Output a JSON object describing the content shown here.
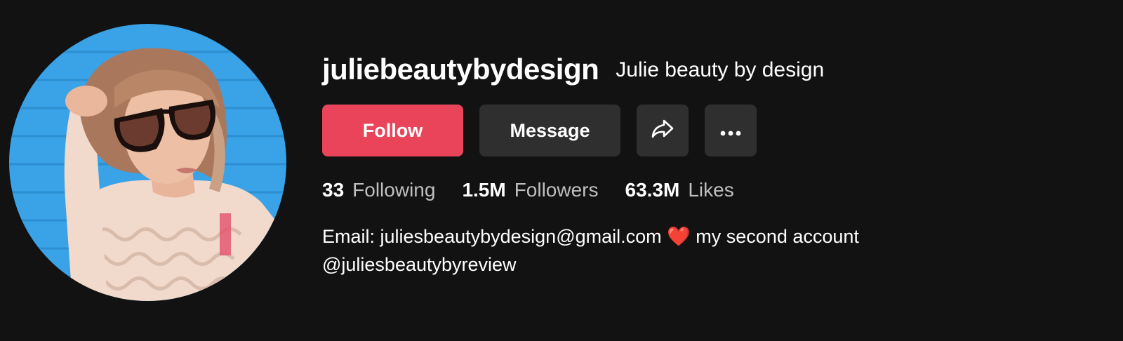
{
  "profile": {
    "username": "juliebeautybydesign",
    "display_name": "Julie beauty by design"
  },
  "actions": {
    "follow_label": "Follow",
    "message_label": "Message",
    "share_icon": "share-icon",
    "more_icon": "more-icon"
  },
  "stats": {
    "following_count": "33",
    "following_label": "Following",
    "followers_count": "1.5M",
    "followers_label": "Followers",
    "likes_count": "63.3M",
    "likes_label": "Likes"
  },
  "bio": {
    "line1_prefix": "Email: juliesbeautybydesign@gmail.com",
    "heart_glyph": "❤️",
    "line1_suffix": "my second account",
    "line2": "@juliesbeautybyreview"
  },
  "colors": {
    "background": "#121212",
    "follow_button": "#ea445a",
    "secondary_button": "#2f2f2f",
    "stat_label": "#bfbfbf"
  }
}
